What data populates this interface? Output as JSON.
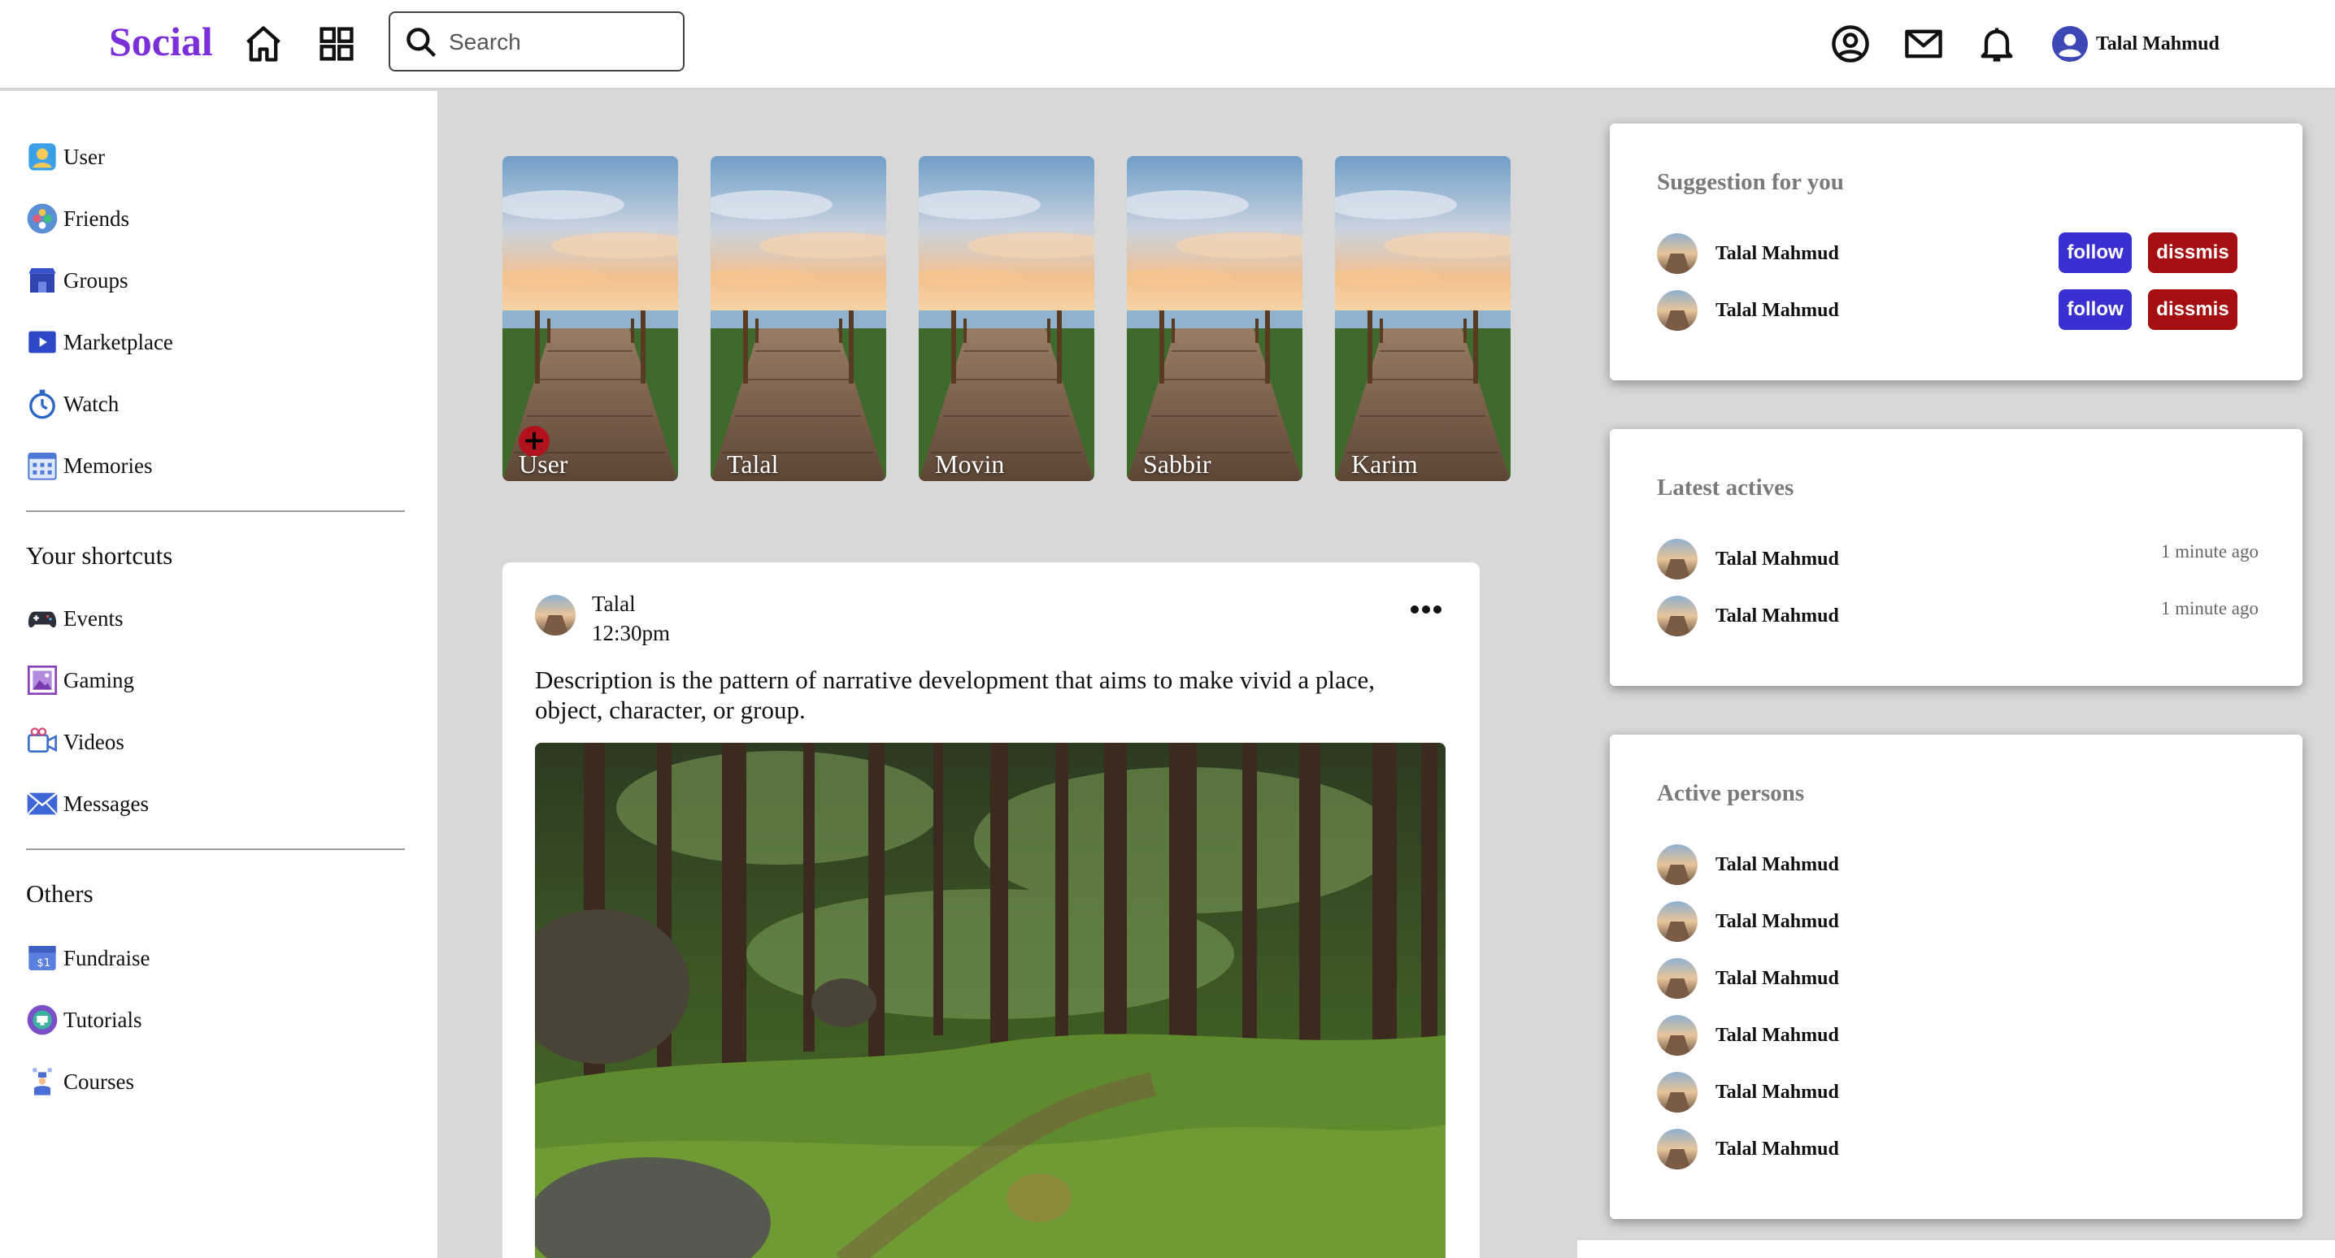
{
  "brand": {
    "name": "Social",
    "color": "#7b2fd8"
  },
  "header": {
    "search": {
      "placeholder": "Search",
      "value": ""
    },
    "icons": [
      "home-icon",
      "grid-icon",
      "account-icon",
      "mail-icon",
      "bell-icon"
    ],
    "user": {
      "name": "Talal Mahmud"
    }
  },
  "sidebar": {
    "main": [
      {
        "label": "User",
        "icon": "user-icon"
      },
      {
        "label": "Friends",
        "icon": "friends-icon"
      },
      {
        "label": "Groups",
        "icon": "groups-icon"
      },
      {
        "label": "Marketplace",
        "icon": "marketplace-icon"
      },
      {
        "label": "Watch",
        "icon": "watch-icon"
      },
      {
        "label": "Memories",
        "icon": "memories-icon"
      }
    ],
    "shortcuts_heading": "Your shortcuts",
    "shortcuts": [
      {
        "label": "Events",
        "icon": "events-icon"
      },
      {
        "label": "Gaming",
        "icon": "gaming-icon"
      },
      {
        "label": "Videos",
        "icon": "videos-icon"
      },
      {
        "label": "Messages",
        "icon": "messages-icon"
      }
    ],
    "others_heading": "Others",
    "others": [
      {
        "label": "Fundraise",
        "icon": "fundraise-icon"
      },
      {
        "label": "Tutorials",
        "icon": "tutorials-icon"
      },
      {
        "label": "Courses",
        "icon": "courses-icon"
      }
    ]
  },
  "stories": [
    {
      "name": "User",
      "add": true
    },
    {
      "name": "Talal"
    },
    {
      "name": "Movin"
    },
    {
      "name": "Sabbir"
    },
    {
      "name": "Karim"
    }
  ],
  "post": {
    "author": "Talal",
    "time": "12:30pm",
    "description": "Description is the pattern of narrative development that aims to make vivid a place, object, character, or group."
  },
  "suggestions": {
    "title": "Suggestion for you",
    "follow_label": "follow",
    "dismiss_label": "dissmis",
    "people": [
      "Talal Mahmud",
      "Talal Mahmud"
    ]
  },
  "latest": {
    "title": "Latest actives",
    "items": [
      {
        "name": "Talal Mahmud",
        "time": "1 minute ago"
      },
      {
        "name": "Talal Mahmud",
        "time": "1 minute ago"
      }
    ]
  },
  "active": {
    "title": "Active persons",
    "people": [
      "Talal Mahmud",
      "Talal Mahmud",
      "Talal Mahmud",
      "Talal Mahmud",
      "Talal Mahmud",
      "Talal Mahmud"
    ]
  },
  "colors": {
    "follow": "#3a2fd0",
    "dismiss": "#a60f12",
    "page_bg": "#d8d8d8"
  }
}
